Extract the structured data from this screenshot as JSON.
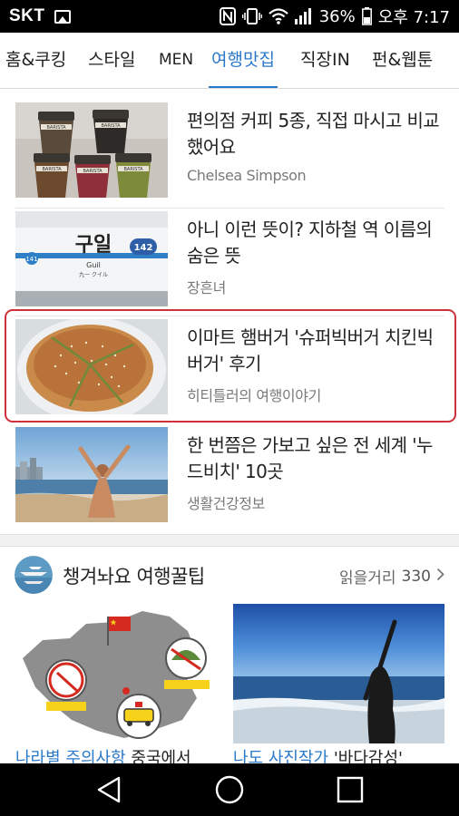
{
  "status_bar": {
    "carrier": "SKT",
    "battery": "36%",
    "time": "오후 7:17",
    "icons": [
      "image-icon",
      "nfc-icon",
      "vibrate-icon",
      "wifi-icon",
      "signal-icon",
      "battery-icon"
    ]
  },
  "tabs": [
    {
      "label": "홈&쿠킹"
    },
    {
      "label": "스타일"
    },
    {
      "label": "MEN"
    },
    {
      "label": "여행맛집",
      "active": true
    },
    {
      "label": "직장IN"
    },
    {
      "label": "펀&웹툰"
    }
  ],
  "articles": [
    {
      "title": "편의점 커피 5종, 직접 마시고 비교했어요",
      "source": "Chelsea Simpson",
      "thumb": "coffee-cups-image"
    },
    {
      "title": "아니 이런 뜻이? 지하철 역 이름의 숨은 뜻",
      "source": "장흔녀",
      "thumb": "subway-sign-image",
      "sign_text": "구일",
      "sign_sub": "Guil",
      "sign_sub2": "九一 クイル",
      "sign_number": "142",
      "sign_number_left": "141"
    },
    {
      "title": "이마트 햄버거 '슈퍼빅버거 치킨빅버거' 후기",
      "source": "히티틀러의 여행이야기",
      "thumb": "burger-image",
      "highlighted": true
    },
    {
      "title": "한 번쯤은 가보고 싶은 전 세계 '누드비치' 10곳",
      "source": "생활건강정보",
      "thumb": "beach-image"
    }
  ],
  "cup_label": "BARISTA",
  "section": {
    "title": "챙겨놔요 여행꿀팁",
    "more_label": "읽을거리",
    "count": "330",
    "cards": [
      {
        "caption_blue": "나라별 주의사항",
        "caption_black": " 중국에서",
        "thumb": "china-map-image"
      },
      {
        "caption_blue": "나도 사진작가",
        "caption_black": " '바다감성'",
        "thumb": "sea-silhouette-image"
      }
    ]
  },
  "nav": {
    "buttons": [
      "back-icon",
      "home-icon",
      "recents-icon"
    ]
  },
  "colors": {
    "accent": "#2a78c9",
    "highlight": "#d0303a"
  }
}
